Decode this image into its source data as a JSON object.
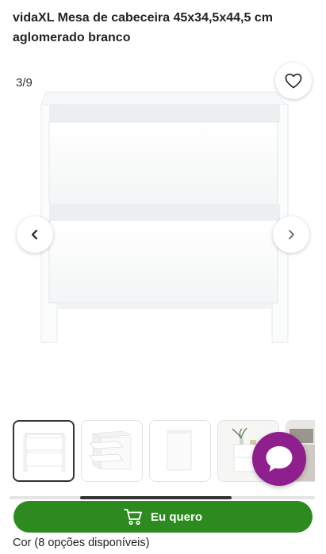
{
  "product": {
    "title": "vidaXL Mesa de cabeceira 45x34,5x44,5 cm aglomerado branco"
  },
  "gallery": {
    "counter": "3/9",
    "thumbnails": [
      {
        "name": "thumb-front-view"
      },
      {
        "name": "thumb-drawers-open"
      },
      {
        "name": "thumb-side-view"
      },
      {
        "name": "thumb-styled-room"
      },
      {
        "name": "thumb-room-partial"
      }
    ]
  },
  "cta": {
    "label": "Eu quero"
  },
  "options": {
    "color_label": "Cor (8 opções disponíveis)"
  },
  "colors": {
    "cta_green": "#2c8a1f",
    "chat_purple": "#8e1f8c"
  },
  "icons": [
    "heart-icon",
    "chevron-left-icon",
    "chevron-right-icon",
    "cart-icon",
    "chat-bubble-icon"
  ]
}
